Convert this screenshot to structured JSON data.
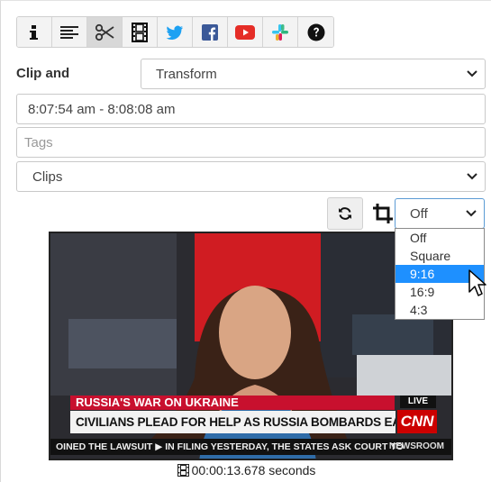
{
  "toolbar": {
    "items": [
      {
        "name": "info-icon"
      },
      {
        "name": "align-left-icon"
      },
      {
        "name": "scissors-icon",
        "active": true
      },
      {
        "name": "film-icon"
      },
      {
        "name": "twitter-icon",
        "color": "#1da1f2"
      },
      {
        "name": "facebook-icon",
        "color": "#3b5998"
      },
      {
        "name": "youtube-icon",
        "color": "#e52d27"
      },
      {
        "name": "slack-icon"
      },
      {
        "name": "help-icon"
      }
    ]
  },
  "clip_label": "Clip and",
  "transform_select": {
    "value": "Transform"
  },
  "time_range": {
    "value": "8:07:54 am - 8:08:08 am"
  },
  "tags": {
    "placeholder": "Tags"
  },
  "clips_select": {
    "value": "Clips"
  },
  "aspect_select": {
    "value": "Off",
    "options": [
      "Off",
      "Square",
      "9:16",
      "16:9",
      "4:3"
    ],
    "highlighted": "9:16"
  },
  "video": {
    "banner": "RUSSIA'S WAR ON UKRAINE",
    "headline": "CIVILIANS PLEAD FOR HELP AS RUSSIA BOMBARDS EASTERN UKRAINE",
    "ticker": "OINED THE LAWSUIT  ▶  IN FILING YESTERDAY, THE STATES ASK COURT TO",
    "live": "LIVE",
    "network": "CNN",
    "show": "NEWSROOM"
  },
  "duration": "00:00:13.678 seconds",
  "colors": {
    "accent": "#1e90ff",
    "focus_border": "#5b9bd5"
  }
}
